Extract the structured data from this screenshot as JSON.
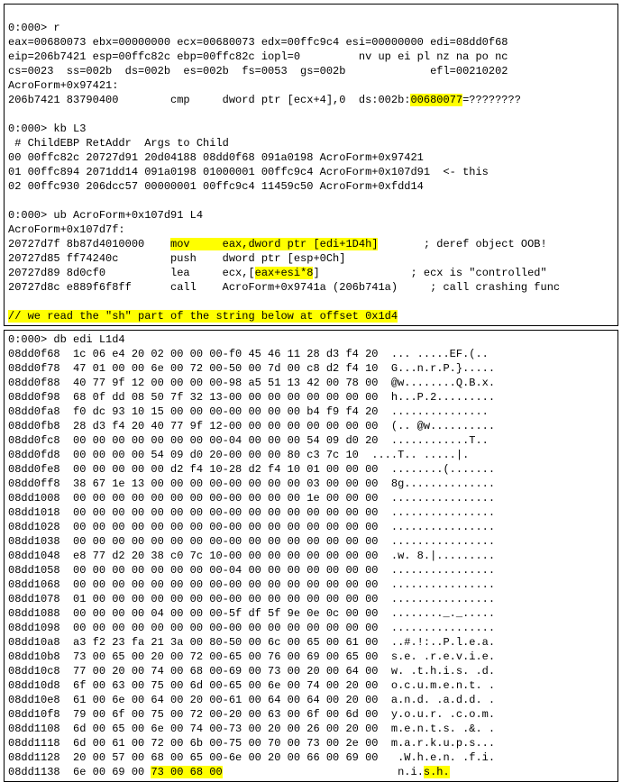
{
  "top": {
    "prompt1": "0:000> r",
    "reg1": "eax=00680073 ebx=00000000 ecx=00680073 edx=00ffc9c4 esi=00000000 edi=08dd0f68",
    "reg2": "eip=206b7421 esp=00ffc82c ebp=00ffc82c iopl=0         nv up ei pl nz na po nc",
    "reg3": "cs=0023  ss=002b  ds=002b  es=002b  fs=0053  gs=002b             efl=00210202",
    "loc": "AcroForm+0x97421:",
    "dis_pre": "206b7421 83790400        cmp     dword ptr [ecx+4],0  ds:002b:",
    "dis_hl": "00680077",
    "dis_post": "=????????",
    "prompt2": "0:000> kb L3",
    "kbhdr": " # ChildEBP RetAddr  Args to Child",
    "kb0": "00 00ffc82c 20727d91 20d04188 08dd0f68 091a0198 AcroForm+0x97421",
    "kb1": "01 00ffc894 2071dd14 091a0198 01000001 00ffc9c4 AcroForm+0x107d91  <- this",
    "kb2": "02 00ffc930 206dcc57 00000001 00ffc9c4 11459c50 AcroForm+0xfdd14",
    "prompt3": "0:000> ub AcroForm+0x107d91 L4",
    "loc2": "AcroForm+0x107d7f:",
    "u0_a": "20727d7f 8b87d4010000    ",
    "u0_b": "mov     eax,dword ptr [edi+1D4h]",
    "u0_c": "       ; deref object OOB!",
    "u1": "20727d85 ff74240c        push    dword ptr [esp+0Ch]",
    "u2_a": "20727d89 8d0cf0          lea     ecx,[",
    "u2_b": "eax+esi*8",
    "u2_c": "]              ; ecx is \"controlled\"",
    "u3": "20727d8c e889f6f8ff      call    AcroForm+0x9741a (206b741a)     ; call crashing func",
    "comment": "// we read the \"sh\" part of the string below at offset 0x1d4"
  },
  "dump": {
    "prompt": "0:000> db edi L1d4",
    "rows": [
      {
        "a": "08dd0f68",
        "h": "1c 06 e4 20 02 00 00 00-f0 45 46 11 28 d3 f4 20",
        "s": "... .....EF.(.. "
      },
      {
        "a": "08dd0f78",
        "h": "47 01 00 00 6e 00 72 00-50 00 7d 00 c8 d2 f4 10",
        "s": "G...n.r.P.}....."
      },
      {
        "a": "08dd0f88",
        "h": "40 77 9f 12 00 00 00 00-98 a5 51 13 42 00 78 00",
        "s": "@w........Q.B.x."
      },
      {
        "a": "08dd0f98",
        "h": "68 0f dd 08 50 7f 32 13-00 00 00 00 00 00 00 00",
        "s": "h...P.2........."
      },
      {
        "a": "08dd0fa8",
        "h": "f0 dc 93 10 15 00 00 00-00 00 00 00 b4 f9 f4 20",
        "s": "............... "
      },
      {
        "a": "08dd0fb8",
        "h": "28 d3 f4 20 40 77 9f 12-00 00 00 00 00 00 00 00",
        "s": "(.. @w.........."
      },
      {
        "a": "08dd0fc8",
        "h": "00 00 00 00 00 00 00 00-04 00 00 00 54 09 d0 20",
        "s": "............T.. "
      },
      {
        "a": "08dd0fd8",
        "h": "00 00 00 00 54 09 d0 20-00 00 00 80 c3 7c 10",
        "s": "....T.. .....|."
      },
      {
        "a": "08dd0fe8",
        "h": "00 00 00 00 00 d2 f4 10-28 d2 f4 10 01 00 00 00",
        "s": "........(......."
      },
      {
        "a": "08dd0ff8",
        "h": "38 67 1e 13 00 00 00 00-00 00 00 00 03 00 00 00",
        "s": "8g.............."
      },
      {
        "a": "08dd1008",
        "h": "00 00 00 00 00 00 00 00-00 00 00 00 1e 00 00 00",
        "s": "................"
      },
      {
        "a": "08dd1018",
        "h": "00 00 00 00 00 00 00 00-00 00 00 00 00 00 00 00",
        "s": "................"
      },
      {
        "a": "08dd1028",
        "h": "00 00 00 00 00 00 00 00-00 00 00 00 00 00 00 00",
        "s": "................"
      },
      {
        "a": "08dd1038",
        "h": "00 00 00 00 00 00 00 00-00 00 00 00 00 00 00 00",
        "s": "................"
      },
      {
        "a": "08dd1048",
        "h": "e8 77 d2 20 38 c0 7c 10-00 00 00 00 00 00 00 00",
        "s": ".w. 8.|........."
      },
      {
        "a": "08dd1058",
        "h": "00 00 00 00 00 00 00 00-04 00 00 00 00 00 00 00",
        "s": "................"
      },
      {
        "a": "08dd1068",
        "h": "00 00 00 00 00 00 00 00-00 00 00 00 00 00 00 00",
        "s": "................"
      },
      {
        "a": "08dd1078",
        "h": "01 00 00 00 00 00 00 00-00 00 00 00 00 00 00 00",
        "s": "................"
      },
      {
        "a": "08dd1088",
        "h": "00 00 00 00 04 00 00 00-5f df 5f 9e 0e 0c 00 00",
        "s": "........_._....."
      },
      {
        "a": "08dd1098",
        "h": "00 00 00 00 00 00 00 00-00 00 00 00 00 00 00 00",
        "s": "................"
      },
      {
        "a": "08dd10a8",
        "h": "a3 f2 23 fa 21 3a 00 80-50 00 6c 00 65 00 61 00",
        "s": "..#.!:..P.l.e.a."
      },
      {
        "a": "08dd10b8",
        "h": "73 00 65 00 20 00 72 00-65 00 76 00 69 00 65 00",
        "s": "s.e. .r.e.v.i.e."
      },
      {
        "a": "08dd10c8",
        "h": "77 00 20 00 74 00 68 00-69 00 73 00 20 00 64 00",
        "s": "w. .t.h.i.s. .d."
      },
      {
        "a": "08dd10d8",
        "h": "6f 00 63 00 75 00 6d 00-65 00 6e 00 74 00 20 00",
        "s": "o.c.u.m.e.n.t. ."
      },
      {
        "a": "08dd10e8",
        "h": "61 00 6e 00 64 00 20 00-61 00 64 00 64 00 20 00",
        "s": "a.n.d. .a.d.d. ."
      },
      {
        "a": "08dd10f8",
        "h": "79 00 6f 00 75 00 72 00-20 00 63 00 6f 00 6d 00",
        "s": "y.o.u.r. .c.o.m."
      },
      {
        "a": "08dd1108",
        "h": "6d 00 65 00 6e 00 74 00-73 00 20 00 26 00 20 00",
        "s": "m.e.n.t.s. .&. ."
      },
      {
        "a": "08dd1118",
        "h": "6d 00 61 00 72 00 6b 00-75 00 70 00 73 00 2e 00",
        "s": "m.a.r.k.u.p.s..."
      },
      {
        "a": "08dd1128",
        "h": "20 00 57 00 68 00 65 00-6e 00 20 00 66 00 69 00",
        "s": " .W.h.e.n. .f.i."
      }
    ],
    "last": {
      "a": "08dd1138",
      "h_pre": "6e 00 69 00 ",
      "h_hl": "73 00 68 00",
      "s_pre": "n.i.",
      "s_hl": "s.h.",
      "s_post": ""
    }
  }
}
